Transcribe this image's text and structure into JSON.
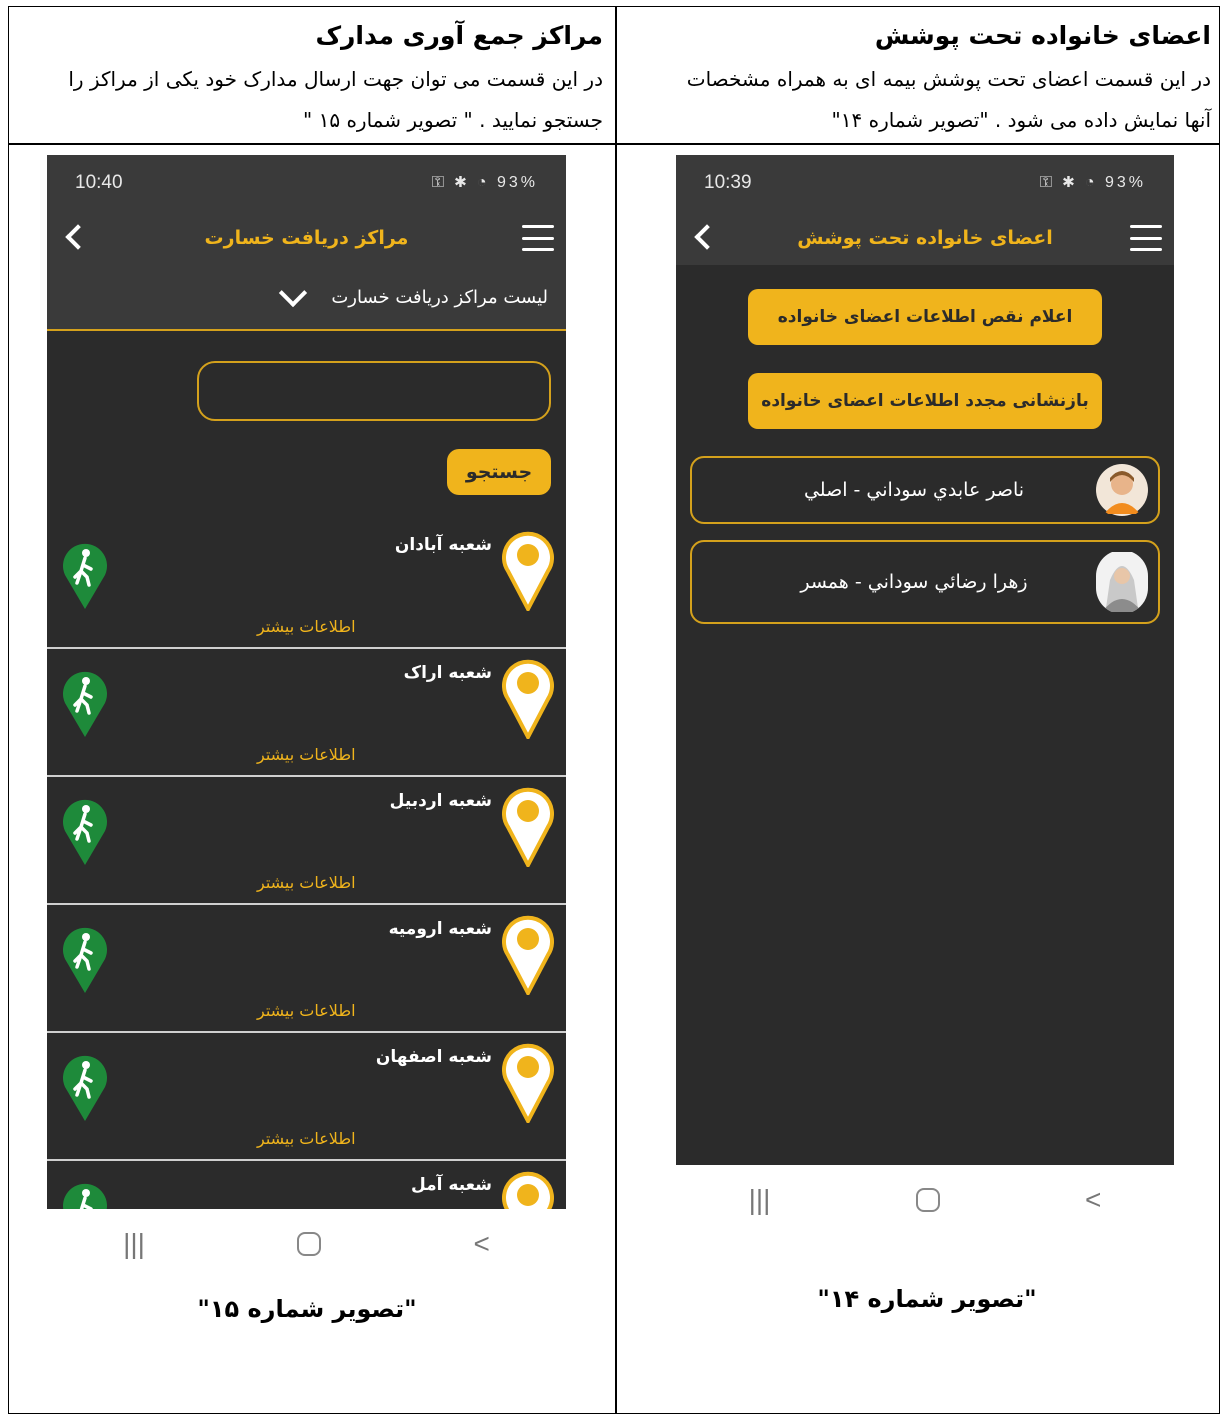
{
  "cells": {
    "right": {
      "title": "اعضای خانواده تحت پوشش",
      "desc_line1": "در این قسمت اعضای تحت پوشش بیمه ای به همراه مشخصات",
      "desc_line2": "آنها نمایش داده می شود . \"تصویر شماره ۱۴\""
    },
    "left": {
      "title": "مراکز جمع آوری مدارک",
      "desc_line1": "در این قسمت می توان جهت ارسال مدارک خود یکی از مراکز را",
      "desc_line2": "جستجو نمایید . \" تصویر شماره ۱۵ \""
    }
  },
  "screen14": {
    "time": "10:39",
    "battery": "93%",
    "title": "اعضای خانواده تحت پوشش",
    "buttons": [
      "اعلام نقص اطلاعات اعضای خانواده",
      "بازنشانی مجدد اطلاعات اعضای خانواده"
    ],
    "members": [
      "ناصر عابدي سوداني - اصلي",
      "زهرا رضائي سوداني - همسر"
    ],
    "caption": "\"تصویر شماره ۱۴\""
  },
  "screen15": {
    "time": "10:40",
    "battery": "93%",
    "title": "مراکز دریافت خسارت",
    "list_header": "لیست مراکز دریافت خسارت",
    "search_button": "جستجو",
    "more_label": "اطلاعات بیشتر",
    "branches": [
      "شعبه آبادان",
      "شعبه اراک",
      "شعبه اردبیل",
      "شعبه ارومیه",
      "شعبه اصفهان",
      "شعبه آمل"
    ],
    "caption": "\"تصویر شماره ۱۵\""
  },
  "colors": {
    "accent": "#f0b41c",
    "screen_bg": "#2b2b2b",
    "walk_green": "#1e8a3a"
  },
  "icons": [
    "back-arrow-icon",
    "hamburger-menu-icon",
    "chevron-down-icon",
    "map-pin-icon",
    "walking-person-icon",
    "avatar-male-icon",
    "avatar-female-icon"
  ]
}
